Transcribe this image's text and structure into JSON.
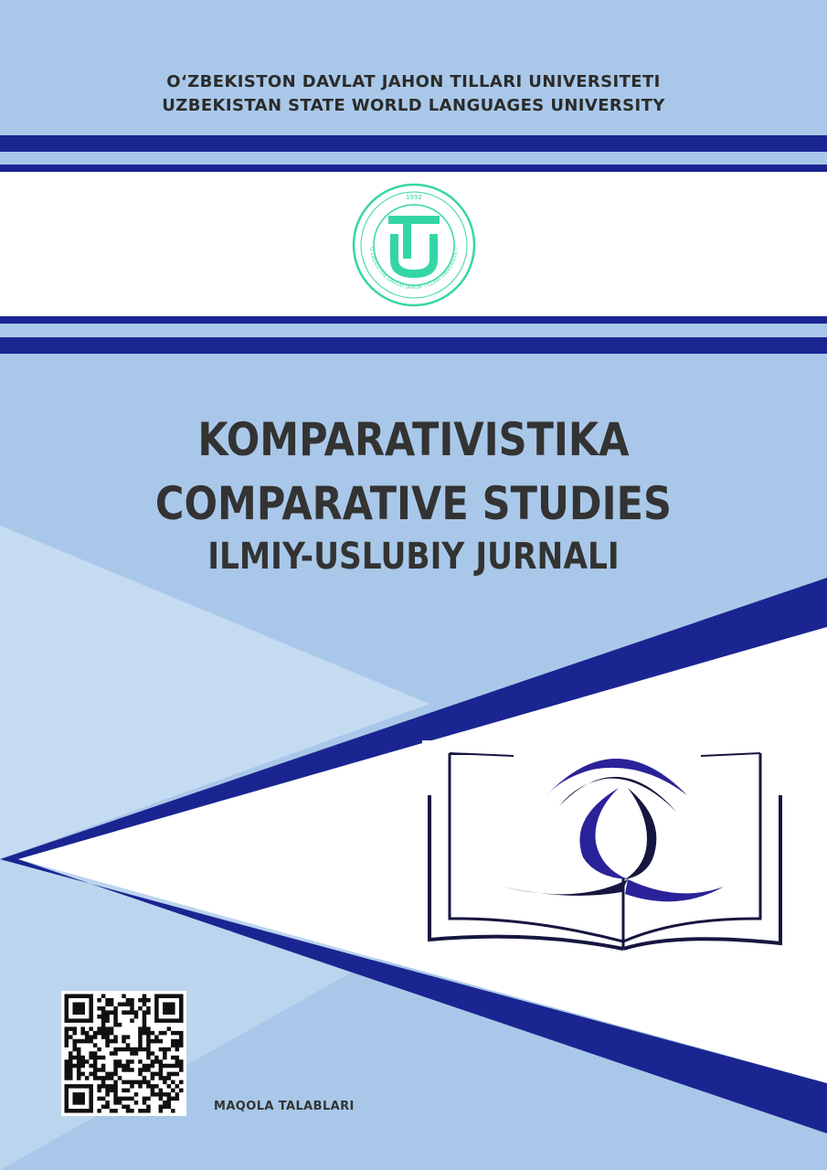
{
  "header": {
    "university_uz": "O‘ZBEKISTON DAVLAT JAHON TILLARI UNIVERSITETI",
    "university_en": "UZBEKISTAN STATE WORLD LANGUAGES UNIVERSITY"
  },
  "seal": {
    "year": "1992",
    "ring_text": "O'ZBEKISTON DAVLAT JAHON TILLARI UNIVERSITETI",
    "color": "#35d6a6"
  },
  "journal": {
    "title_uz": "KOMPARATIVISTIKA",
    "title_en": "COMPARATIVE STUDIES",
    "subtitle": "ILMIY-USLUBIY JURNALI"
  },
  "footer": {
    "requirements_label": "MAQOLA TALABLARI"
  },
  "colors": {
    "background": "#a9c8e9",
    "light_blue": "#c5dbf2",
    "navy": "#1b2591",
    "text": "#333333",
    "book_indigo": "#2a229a",
    "book_dark": "#161640"
  },
  "icons": [
    "university-seal-icon",
    "open-book-emblem-icon",
    "qr-code-icon"
  ]
}
